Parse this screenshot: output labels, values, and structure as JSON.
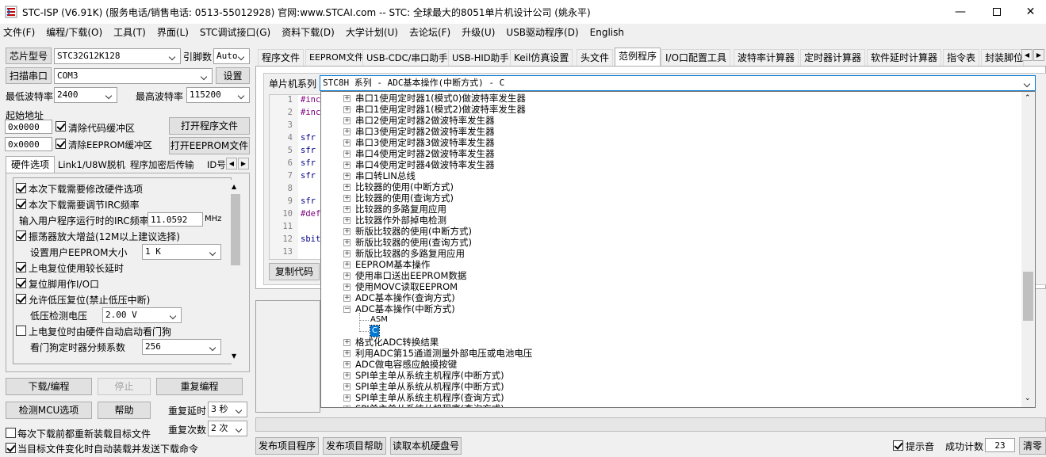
{
  "window": {
    "title": "STC-ISP (V6.91K) (服务电话/销售电话: 0513-55012928) 官网:www.STCAI.com  -- STC: 全球最大的8051单片机设计公司 (姚永平)"
  },
  "menu": [
    "文件(F)",
    "编程/下载(O)",
    "工具(T)",
    "界面(L)",
    "STC调试接口(G)",
    "资料下载(D)",
    "大学计划(U)",
    "去论坛(F)",
    "升级(U)",
    "USB驱动程序(D)",
    "English"
  ],
  "left": {
    "chip_label": "芯片型号",
    "chip_value": "STC32G12K128",
    "pin_label": "引脚数",
    "pin_value": "Auto",
    "scan_button": "扫描串口",
    "port_value": "COM3",
    "settings_button": "设置",
    "min_baud_label": "最低波特率",
    "min_baud_value": "2400",
    "max_baud_label": "最高波特率",
    "max_baud_value": "115200",
    "start_addr_label": "起始地址",
    "addr1": "0x0000",
    "clear_code": "清除代码缓冲区",
    "open_program": "打开程序文件",
    "addr2": "0x0000",
    "clear_eeprom": "清除EEPROM缓冲区",
    "open_eeprom": "打开EEPROM文件",
    "tabs": [
      "硬件选项",
      "Link1/U8W脱机",
      "程序加密后传输",
      "ID号"
    ],
    "options": {
      "o1": "本次下载需要修改硬件选项",
      "o2": "本次下载需要调节IRC频率",
      "irc_label": "输入用户程序运行时的IRC频率",
      "irc_value": "11.0592",
      "irc_unit": "MHz",
      "o3": "振荡器放大增益(12M以上建议选择)",
      "eeprom_label": "设置用户EEPROM大小",
      "eeprom_value": "1   K",
      "o4": "上电复位使用较长延时",
      "o5": "复位脚用作I/O口",
      "o6": "允许低压复位(禁止低压中断)",
      "lv_label": "低压检测电压",
      "lv_value": "2.00 V",
      "o7": "上电复位时由硬件自动启动看门狗",
      "wdt_label": "看门狗定时器分频系数",
      "wdt_value": "256"
    },
    "download_button": "下载/编程",
    "stop_button": "停止",
    "reprogram_button": "重复编程",
    "detect_button": "检测MCU选项",
    "help_button": "帮助",
    "delay_label": "重复延时",
    "delay_value": "3 秒",
    "reload_each": "每次下载前都重新装载目标文件",
    "count_label": "重复次数",
    "count_value": "2 次",
    "auto_reload": "当目标文件变化时自动装载并发送下载命令"
  },
  "right": {
    "tabs": [
      "程序文件",
      "EEPROM文件",
      "USB-CDC/串口助手",
      "USB-HID助手",
      "Keil仿真设置",
      "头文件",
      "范例程序",
      "I/O口配置工具",
      "波特率计算器",
      "定时器计算器",
      "软件延时计算器",
      "指令表",
      "封装脚位"
    ],
    "series_label": "单片机系列",
    "series_value": "STC8H 系列 - ADC基本操作(中断方式) - C",
    "line_numbers": [
      "1",
      "2",
      "3",
      "4",
      "5",
      "6",
      "7",
      "8",
      "9",
      "10",
      "11",
      "12",
      "13"
    ],
    "code_lines": [
      "#inc",
      "#inc",
      "",
      "sfr",
      "sfr",
      "sfr",
      "sfr",
      "",
      "sfr",
      "#def",
      "",
      "sbit",
      ""
    ],
    "copy_button": "复制代码",
    "tree": [
      "串口1使用定时器1(模式0)做波特率发生器",
      "串口1使用定时器1(模式2)做波特率发生器",
      "串口2使用定时器2做波特率发生器",
      "串口3使用定时器2做波特率发生器",
      "串口3使用定时器3做波特率发生器",
      "串口4使用定时器2做波特率发生器",
      "串口4使用定时器4做波特率发生器",
      "串口转LIN总线",
      "比较器的使用(中断方式)",
      "比较器的使用(查询方式)",
      "比较器的多路复用应用",
      "比较器作外部掉电检测",
      "新版比较器的使用(中断方式)",
      "新版比较器的使用(查询方式)",
      "新版比较器的多路复用应用",
      "EEPROM基本操作",
      "使用串口送出EEPROM数据",
      "使用MOVC读取EEPROM",
      "ADC基本操作(查询方式)",
      "ADC基本操作(中断方式)",
      "ASM",
      "C",
      "格式化ADC转换结果",
      "利用ADC第15通道测量外部电压或电池电压",
      "ADC做电容感应触摸按键",
      "SPI单主单从系统主机程序(中断方式)",
      "SPI单主单从系统从机程序(中断方式)",
      "SPI单主单从系统主机程序(查询方式)",
      "SPI单主单从系统从机程序(查询方式)"
    ],
    "bottom_buttons": [
      "发布项目程序",
      "发布项目帮助",
      "读取本机硬盘号"
    ],
    "sound_label": "提示音",
    "success_label": "成功计数",
    "success_value": "23",
    "clear_button": "清零"
  }
}
